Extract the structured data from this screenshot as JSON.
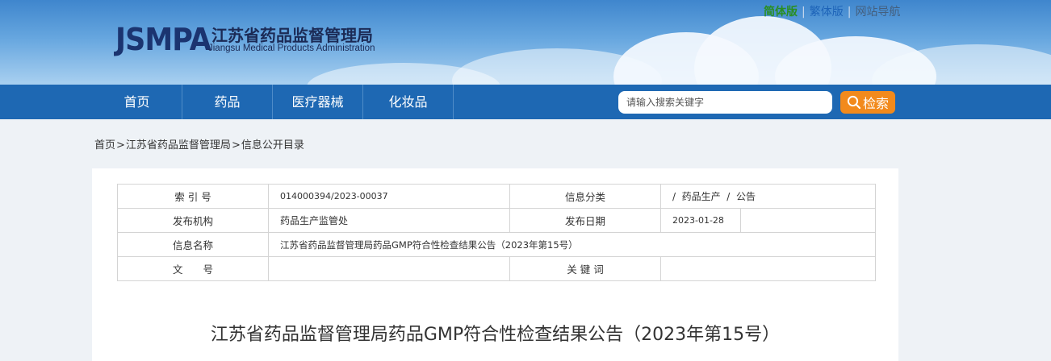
{
  "header": {
    "logo_mark": "JSMPA",
    "logo_cn": "江苏省药品监督管理局",
    "logo_en": "Jiangsu Medical Products Administration",
    "top_links": [
      {
        "label": "简体版",
        "color": "#2a8e22"
      },
      {
        "label": "繁体版",
        "color": "#1d63b8"
      },
      {
        "label": "网站导航",
        "color": "#44607f"
      }
    ]
  },
  "nav": {
    "items": [
      "首页",
      "药品",
      "医疗器械",
      "化妆品"
    ],
    "search_placeholder": "请输入搜索关键字",
    "search_button": "检索",
    "search_icon": "magnifier-icon"
  },
  "breadcrumb": {
    "items": [
      "首页",
      "江苏省药品监督管理局",
      "信息公开目录"
    ],
    "separator": ">"
  },
  "meta_table": {
    "index_label": "索 引 号",
    "index_value": "014000394/2023-00037",
    "category_label": "信息分类",
    "category_value": "/  药品生产  /  公告",
    "publisher_label": "发布机构",
    "publisher_value": "药品生产监管处",
    "date_label": "发布日期",
    "date_value": "2023-01-28",
    "name_label": "信息名称",
    "name_value": "江苏省药品监督管理局药品GMP符合性检查结果公告（2023年第15号）",
    "docno_label": "文　　号",
    "docno_value": "",
    "keywords_label": "关 键 词",
    "keywords_value": ""
  },
  "article": {
    "title": "江苏省药品监督管理局药品GMP符合性检查结果公告（2023年第15号）"
  },
  "colors": {
    "nav_bar": "#1e68b3",
    "search_button": "#f28a1c",
    "logo_text": "#1b3470",
    "page_bg": "#eef2f6"
  }
}
